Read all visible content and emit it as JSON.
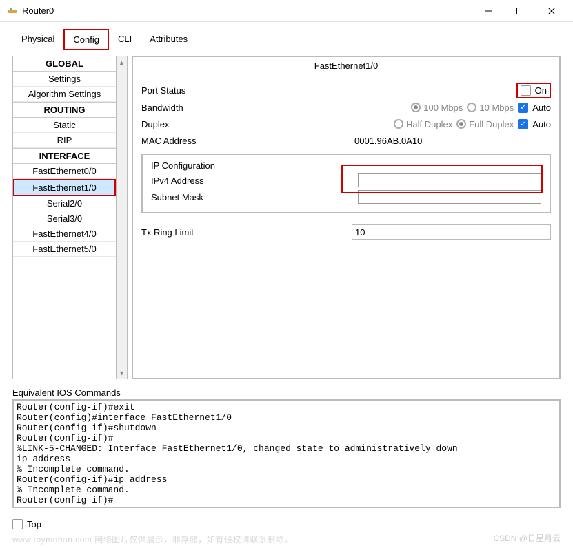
{
  "window": {
    "title": "Router0"
  },
  "tabs": {
    "physical": "Physical",
    "config": "Config",
    "cli": "CLI",
    "attributes": "Attributes"
  },
  "sidebar": {
    "global": "GLOBAL",
    "settings": "Settings",
    "algorithm_settings": "Algorithm Settings",
    "routing": "ROUTING",
    "static": "Static",
    "rip": "RIP",
    "interface": "INTERFACE",
    "fe00": "FastEthernet0/0",
    "fe10": "FastEthernet1/0",
    "s20": "Serial2/0",
    "s30": "Serial3/0",
    "fe40": "FastEthernet4/0",
    "fe50": "FastEthernet5/0"
  },
  "panel": {
    "title": "FastEthernet1/0",
    "port_status_lbl": "Port Status",
    "on_lbl": "On",
    "bandwidth_lbl": "Bandwidth",
    "bw_100": "100 Mbps",
    "bw_10": "10 Mbps",
    "bw_auto": "Auto",
    "duplex_lbl": "Duplex",
    "half_duplex": "Half Duplex",
    "full_duplex": "Full Duplex",
    "dup_auto": "Auto",
    "mac_lbl": "MAC Address",
    "mac_val": "0001.96AB.0A10",
    "ip_config": "IP Configuration",
    "ipv4_lbl": "IPv4 Address",
    "subnet_lbl": "Subnet Mask",
    "ipv4_val": "",
    "subnet_val": "",
    "txring_lbl": "Tx Ring Limit",
    "txring_val": "10"
  },
  "ios": {
    "title": "Equivalent IOS Commands",
    "lines": "Router(config-if)#\nRouter(config-if)#exit\nRouter(config)#interface FastEthernet1/0\nRouter(config-if)#shutdown\nRouter(config-if)#\n%LINK-5-CHANGED: Interface FastEthernet1/0, changed state to administratively down\nip address\n% Incomplete command.\nRouter(config-if)#ip address\n% Incomplete command.\nRouter(config-if)#"
  },
  "footer": {
    "top": "Top"
  },
  "watermark": {
    "left": "www.toymoban.com 网络图片仅供展示，非存储，如有侵权请联系删除。",
    "right": "CSDN @日星月云"
  }
}
